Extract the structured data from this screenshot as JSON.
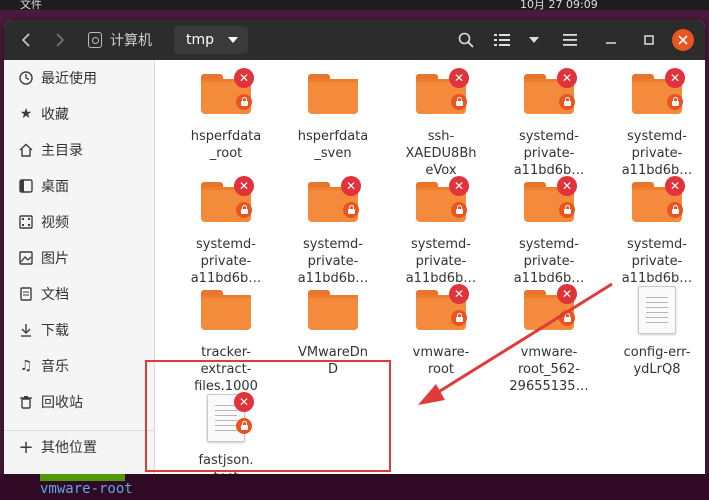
{
  "topbar": {
    "left_text": "文件",
    "right_text": "10月 27 09:09"
  },
  "window": {
    "breadcrumb": {
      "home_label": "计算机",
      "current_label": "tmp"
    },
    "controls": {
      "back": "‹",
      "forward": "›",
      "minimize": "—",
      "maximize": "□",
      "close": "✕"
    }
  },
  "sidebar": {
    "items": [
      {
        "label": "最近使用",
        "icon": "clock-icon"
      },
      {
        "label": "收藏",
        "icon": "star-icon"
      },
      {
        "label": "主目录",
        "icon": "home-icon"
      },
      {
        "label": "桌面",
        "icon": "desktop-icon"
      },
      {
        "label": "视频",
        "icon": "video-icon"
      },
      {
        "label": "图片",
        "icon": "picture-icon"
      },
      {
        "label": "文档",
        "icon": "document-icon"
      },
      {
        "label": "下载",
        "icon": "download-icon"
      },
      {
        "label": "音乐",
        "icon": "music-icon"
      },
      {
        "label": "回收站",
        "icon": "trash-icon"
      },
      {
        "label": "其他位置",
        "icon": "plus-icon"
      }
    ]
  },
  "files": [
    {
      "name": "hsperfdata\n_root",
      "type": "folder",
      "locked": true
    },
    {
      "name": "hsperfdata\n_sven",
      "type": "folder",
      "locked": false
    },
    {
      "name": "ssh-\nXAEDU8Bh\neVox",
      "type": "folder",
      "locked": true
    },
    {
      "name": "systemd-\nprivate-\na11bd6b…",
      "type": "folder",
      "locked": true
    },
    {
      "name": "systemd-\nprivate-\na11bd6b…",
      "type": "folder",
      "locked": true
    },
    {
      "name": "systemd-\nprivate-\na11bd6b…",
      "type": "folder",
      "locked": true
    },
    {
      "name": "systemd-\nprivate-\na11bd6b…",
      "type": "folder",
      "locked": true
    },
    {
      "name": "systemd-\nprivate-\na11bd6b…",
      "type": "folder",
      "locked": true
    },
    {
      "name": "systemd-\nprivate-\na11bd6b…",
      "type": "folder",
      "locked": true
    },
    {
      "name": "systemd-\nprivate-\na11bd6b…",
      "type": "folder",
      "locked": true
    },
    {
      "name": "tracker-\nextract-\nfiles.1000",
      "type": "folder",
      "locked": false
    },
    {
      "name": "VMwareDn\nD",
      "type": "folder",
      "locked": false
    },
    {
      "name": "vmware-\nroot",
      "type": "folder",
      "locked": true
    },
    {
      "name": "vmware-\nroot_562-\n29655135…",
      "type": "folder",
      "locked": true
    },
    {
      "name": "config-err-\nydLrQ8",
      "type": "document",
      "locked": false
    },
    {
      "name": "fastjson.\ntest",
      "type": "document",
      "locked": true
    }
  ],
  "terminal": {
    "line": "vmware-root"
  },
  "colors": {
    "accent": "#e95420",
    "folder": "#f38a3c",
    "highlight": "#e03a3a",
    "emblem_x": "#e0333b"
  }
}
